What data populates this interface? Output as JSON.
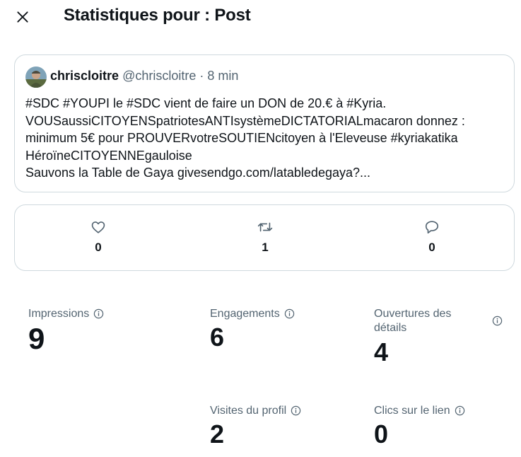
{
  "header": {
    "close_icon": "close-icon",
    "title": "Statistiques pour : Post"
  },
  "post": {
    "author_name": "chriscloitre",
    "author_handle": "@chriscloitre",
    "separator": "·",
    "time": "8 min",
    "text_lines": [
      "#SDC #YOUPI le #SDC vient de faire un DON de 20.€ à  #Kyria.",
      "VOUSaussiCITOYENSpatriotesANTIsystèmeDICTATORIALmacaron donnez  :",
      "minimum 5€ pour PROUVERvotreSOUTIENcitoyen à l'Eleveuse #kyriakatika",
      "HéroïneCITOYENNEgauloise",
      "Sauvons la Table de Gaya givesendgo.com/latabledegaya?..."
    ]
  },
  "actions": {
    "likes": {
      "icon": "heart-icon",
      "count": "0"
    },
    "reposts": {
      "icon": "repost-icon",
      "count": "1"
    },
    "replies": {
      "icon": "reply-icon",
      "count": "0"
    }
  },
  "metrics": {
    "impressions": {
      "label": "Impressions",
      "value": "9"
    },
    "engagements": {
      "label": "Engagements",
      "value": "6"
    },
    "detail_expands": {
      "label_line1": "Ouvertures des",
      "label_line2": "détails",
      "value": "4"
    },
    "profile_visits": {
      "label": "Visites du profil",
      "value": "2"
    },
    "link_clicks": {
      "label": "Clics sur le lien",
      "value": "0"
    }
  },
  "colors": {
    "text_primary": "#0f1419",
    "text_secondary": "#536471",
    "border": "#cfd9de"
  }
}
